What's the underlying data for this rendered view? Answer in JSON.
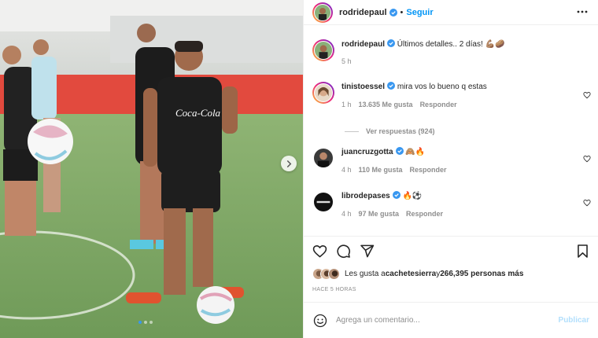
{
  "post": {
    "author": "rodridepaul",
    "verified": true,
    "follow_label": "Seguir",
    "separator": "•",
    "caption_user": "rodridepaul",
    "caption_text": "Últimos detalles.. 2 días! 💪🏽🥔",
    "caption_time": "5 h",
    "carousel": {
      "total": 3,
      "current": 1
    },
    "photo_sponsor": "Coca-Cola"
  },
  "comments": [
    {
      "user": "tinistoessel",
      "verified": true,
      "text": "mira vos lo bueno q estas",
      "time": "1 h",
      "likes": "13.635 Me gusta",
      "reply": "Responder",
      "view_replies": "Ver respuestas (924)"
    },
    {
      "user": "juancruzgotta",
      "verified": true,
      "text": "🙈🔥",
      "time": "4 h",
      "likes": "110 Me gusta",
      "reply": "Responder"
    },
    {
      "user": "librodepases",
      "verified": true,
      "text": "🔥⚽",
      "time": "4 h",
      "likes": "97 Me gusta",
      "reply": "Responder"
    }
  ],
  "likes_summary": {
    "prefix": "Les gusta a ",
    "user": "cachetesierra",
    "middle": " y ",
    "count": "266,395 personas más"
  },
  "time_ago": "HACE 5 HORAS",
  "composer": {
    "placeholder": "Agrega un comentario...",
    "post_label": "Publicar"
  },
  "icons": {
    "like": "heart-icon",
    "comment": "comment-icon",
    "share": "send-icon",
    "save": "bookmark-icon",
    "more": "more-icon",
    "emoji": "emoji-icon",
    "next": "chevron-right-icon"
  },
  "colors": {
    "link": "#0095f6",
    "muted": "#8e8e8e",
    "text": "#262626",
    "post_disabled": "#b2dffc"
  }
}
